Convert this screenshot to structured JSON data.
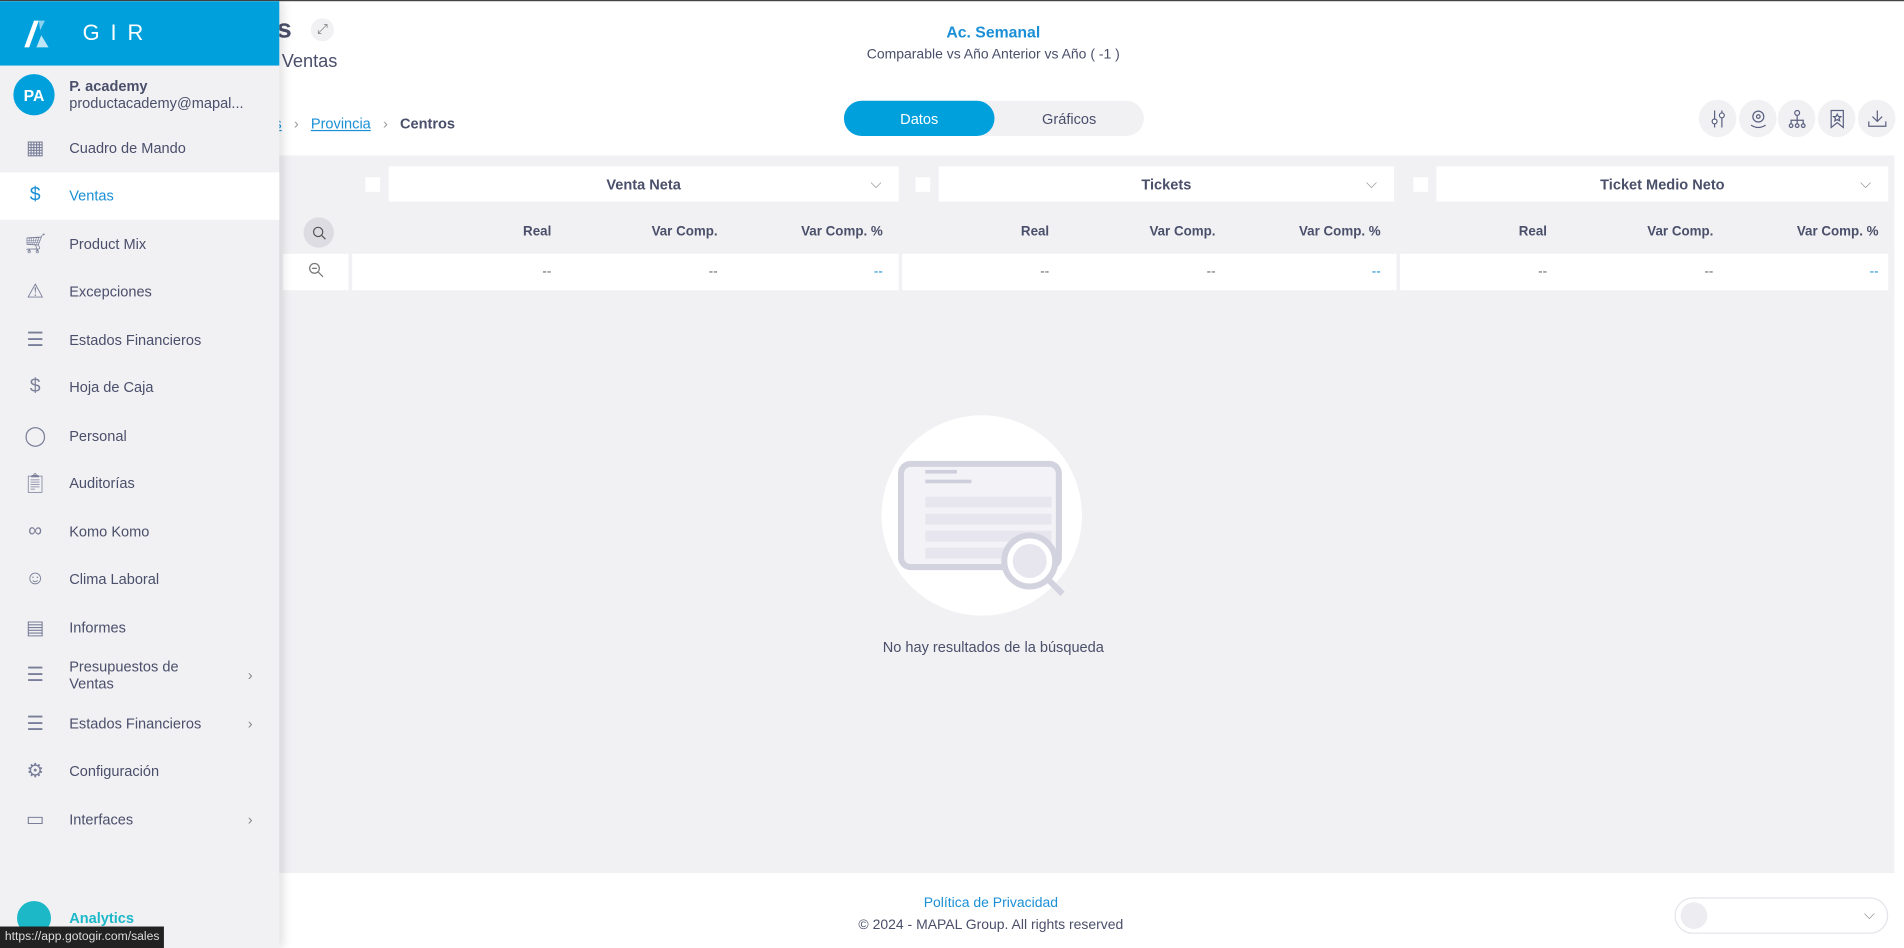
{
  "sidebar": {
    "brand": "GIR",
    "user": {
      "initials": "PA",
      "name": "P. academy",
      "email": "productacademy@mapal..."
    },
    "items": [
      {
        "label": "Cuadro de Mando",
        "icon": "dashboard-icon"
      },
      {
        "label": "Ventas",
        "icon": "sales-icon",
        "active": true
      },
      {
        "label": "Product Mix",
        "icon": "cart-icon"
      },
      {
        "label": "Excepciones",
        "icon": "warning-icon"
      },
      {
        "label": "Estados Financieros",
        "icon": "document-icon"
      },
      {
        "label": "Hoja de Caja",
        "icon": "money-bag-icon"
      },
      {
        "label": "Personal",
        "icon": "person-icon"
      },
      {
        "label": "Auditorías",
        "icon": "clipboard-icon"
      },
      {
        "label": "Komo Komo",
        "icon": "komo-icon"
      },
      {
        "label": "Clima Laboral",
        "icon": "smile-icon"
      },
      {
        "label": "Informes",
        "icon": "report-icon"
      },
      {
        "label": "Presupuestos de Ventas",
        "icon": "budget-icon",
        "submenu": true
      },
      {
        "label": "Estados Financieros",
        "icon": "document-icon",
        "submenu": true
      },
      {
        "label": "Configuración",
        "icon": "gear-icon"
      },
      {
        "label": "Interfaces",
        "icon": "window-icon",
        "submenu": true
      }
    ],
    "analytics": "Analytics"
  },
  "tooltip": "https://app.gotogir.com/sales",
  "header": {
    "title_fragment": "s",
    "subtitle_fragment": "Ventas",
    "period": "Ac. Semanal",
    "comparison": "Comparable vs Año Anterior vs Año ( -1 )"
  },
  "breadcrumb": {
    "first": "s",
    "second": "Provincia",
    "current": "Centros"
  },
  "tabs": {
    "datos": "Datos",
    "graficos": "Gráficos"
  },
  "toolbar": [
    "filters-icon",
    "location-icon",
    "hierarchy-icon",
    "bookmark-icon",
    "download-icon"
  ],
  "table": {
    "groups": [
      {
        "metric": "Venta Neta"
      },
      {
        "metric": "Tickets"
      },
      {
        "metric": "Ticket Medio Neto"
      }
    ],
    "columns": [
      "Real",
      "Var Comp.",
      "Var Comp. %"
    ],
    "empty_value": "--"
  },
  "empty": {
    "message": "No hay resultados de la búsqueda"
  },
  "footer": {
    "privacy": "Política de Privacidad",
    "copyright": "© 2024 - MAPAL Group. All rights reserved"
  },
  "colors": {
    "accent": "#00a0dc",
    "analytics": "#1cb8c8"
  }
}
